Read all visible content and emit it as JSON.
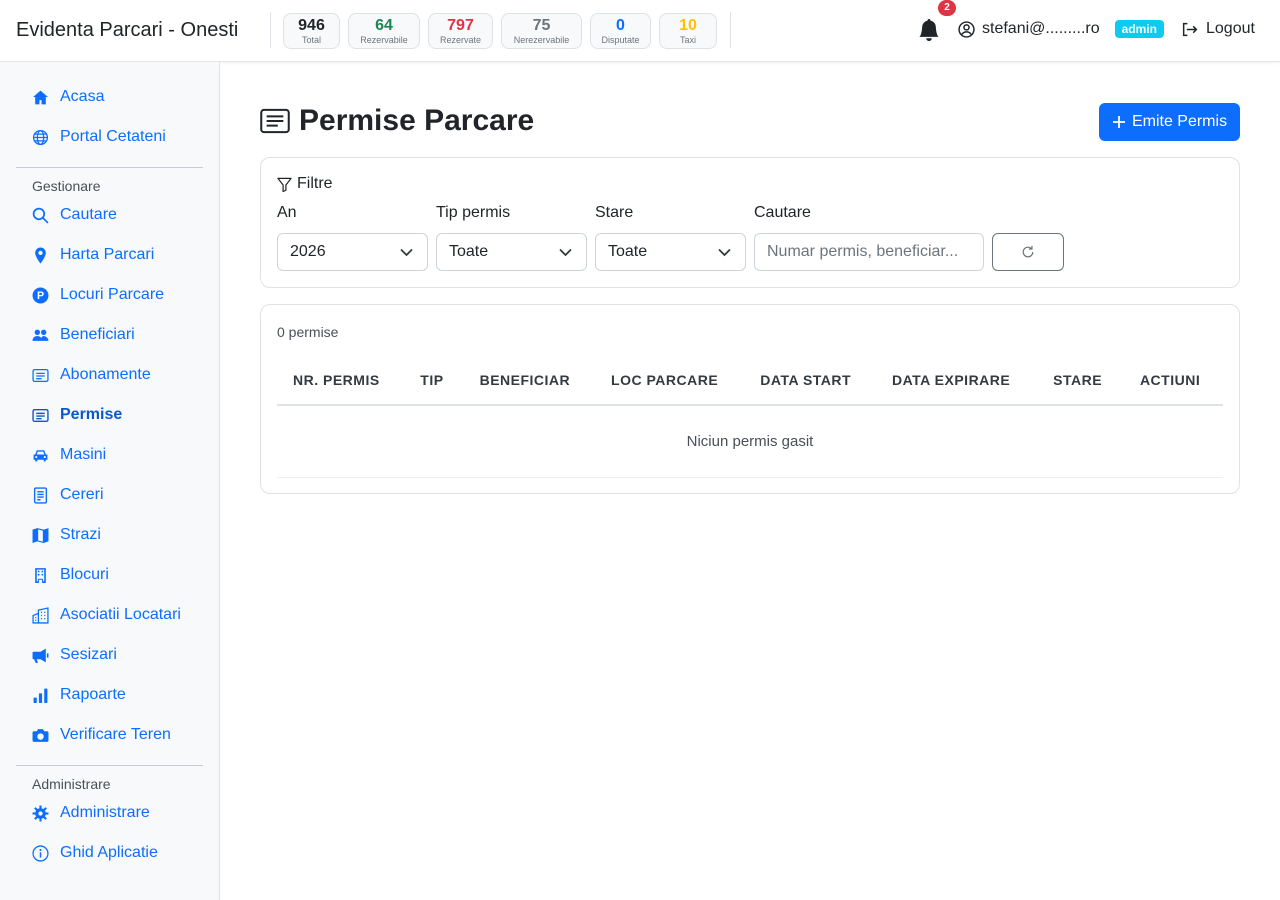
{
  "app": {
    "title": "Evidenta Parcari - Onesti"
  },
  "stats": [
    {
      "value": "946",
      "label": "Total",
      "color": "#212529"
    },
    {
      "value": "64",
      "label": "Rezervabile",
      "color": "#198754"
    },
    {
      "value": "797",
      "label": "Rezervate",
      "color": "#dc3545"
    },
    {
      "value": "75",
      "label": "Nerezervabile",
      "color": "#6c757d"
    },
    {
      "value": "0",
      "label": "Disputate",
      "color": "#0d6efd"
    },
    {
      "value": "10",
      "label": "Taxi",
      "color": "#ffc107"
    }
  ],
  "header": {
    "notifications_count": "2",
    "user_email": "stefani@.........ro",
    "role": "admin",
    "logout_label": "Logout"
  },
  "sidebar": {
    "items": [
      {
        "label": "Acasa",
        "icon": "house-icon"
      },
      {
        "label": "Portal Cetateni",
        "icon": "globe-icon"
      },
      {
        "label": "Cautare",
        "icon": "search-icon"
      },
      {
        "label": "Harta Parcari",
        "icon": "map-pin-icon"
      },
      {
        "label": "Locuri Parcare",
        "icon": "parking-icon"
      },
      {
        "label": "Beneficiari",
        "icon": "people-icon"
      },
      {
        "label": "Abonamente",
        "icon": "card-list-icon"
      },
      {
        "label": "Permise",
        "icon": "card-text-icon",
        "active": true
      },
      {
        "label": "Masini",
        "icon": "car-icon"
      },
      {
        "label": "Cereri",
        "icon": "file-text-icon"
      },
      {
        "label": "Strazi",
        "icon": "map-icon"
      },
      {
        "label": "Blocuri",
        "icon": "building-icon"
      },
      {
        "label": "Asociatii Locatari",
        "icon": "buildings-icon"
      },
      {
        "label": "Sesizari",
        "icon": "megaphone-icon"
      },
      {
        "label": "Rapoarte",
        "icon": "bar-chart-icon"
      },
      {
        "label": "Verificare Teren",
        "icon": "camera-icon"
      },
      {
        "label": "Administrare",
        "icon": "gear-icon"
      },
      {
        "label": "Ghid Aplicatie",
        "icon": "info-circle-icon"
      }
    ],
    "sections": {
      "manage": "Gestionare",
      "admin": "Administrare"
    }
  },
  "main": {
    "title": "Permise Parcare",
    "emit_button": "Emite Permis",
    "filters": {
      "title": "Filtre",
      "year_label": "An",
      "year_value": "2026",
      "type_label": "Tip permis",
      "type_value": "Toate",
      "state_label": "Stare",
      "state_value": "Toate",
      "search_label": "Cautare",
      "search_placeholder": "Numar permis, beneficiar..."
    },
    "table": {
      "count": "0 permise",
      "columns": [
        "Nr. Permis",
        "Tip",
        "Beneficiar",
        "Loc Parcare",
        "Data Start",
        "Data Expirare",
        "Stare",
        "Actiuni"
      ],
      "empty_message": "Niciun permis gasit"
    }
  }
}
